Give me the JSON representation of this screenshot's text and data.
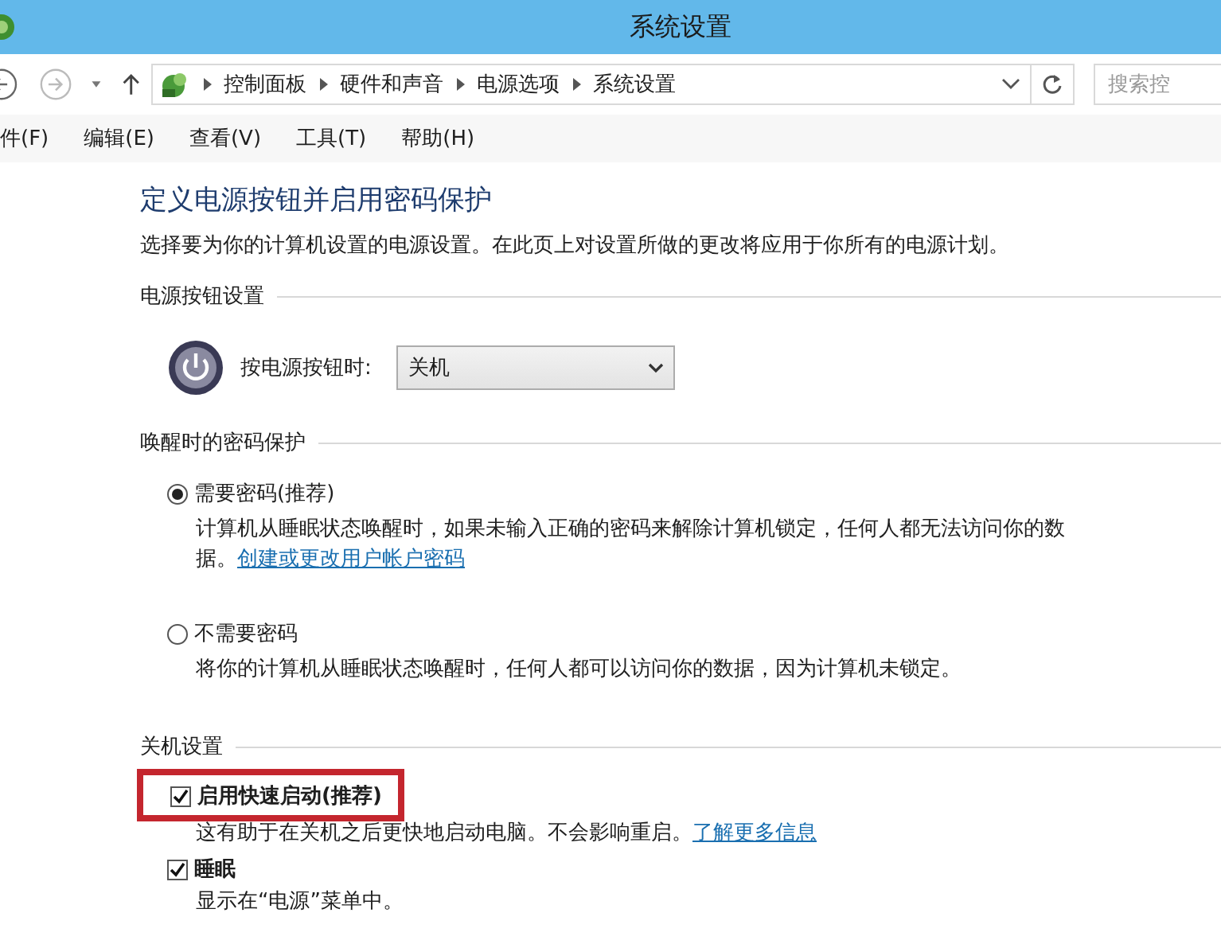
{
  "window": {
    "title": "系统设置"
  },
  "address_bar": {
    "path": [
      "控制面板",
      "硬件和声音",
      "电源选项",
      "系统设置"
    ],
    "search_placeholder": "搜索控"
  },
  "menu": [
    "件(F)",
    "编辑(E)",
    "查看(V)",
    "工具(T)",
    "帮助(H)"
  ],
  "heading": "定义电源按钮并启用密码保护",
  "description": "选择要为你的计算机设置的电源设置。在此页上对设置所做的更改将应用于你所有的电源计划。",
  "power_section": {
    "title": "电源按钮设置",
    "label": "按电源按钮时:",
    "value": "关机"
  },
  "password_section": {
    "title": "唤醒时的密码保护",
    "options": [
      {
        "label": "需要密码(推荐)",
        "selected": true,
        "description": "计算机从睡眠状态唤醒时，如果未输入正确的密码来解除计算机锁定，任何人都无法访问你的数据。",
        "link": "创建或更改用户帐户密码"
      },
      {
        "label": "不需要密码",
        "selected": false,
        "description": "将你的计算机从睡眠状态唤醒时，任何人都可以访问你的数据，因为计算机未锁定。"
      }
    ]
  },
  "shutdown_section": {
    "title": "关机设置",
    "options": [
      {
        "label": "启用快速启动(推荐)",
        "checked": true,
        "highlighted": true,
        "description": "这有助于在关机之后更快地启动电脑。不会影响重启。",
        "link": "了解更多信息"
      },
      {
        "label": "睡眠",
        "checked": true,
        "highlighted": false,
        "description": "显示在“电源”菜单中。"
      }
    ]
  }
}
